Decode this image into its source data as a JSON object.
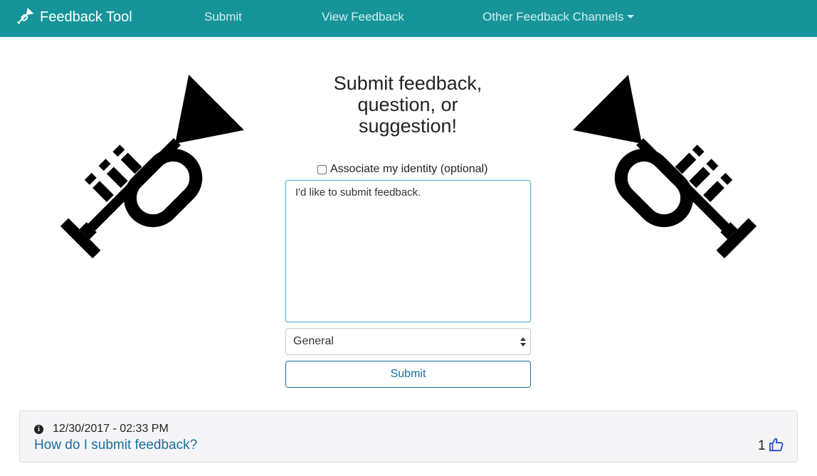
{
  "navbar": {
    "brand": "Feedback Tool",
    "links": {
      "submit": "Submit",
      "view": "View Feedback",
      "other": "Other Feedback Channels"
    },
    "background": "#17949a"
  },
  "form": {
    "title": "Submit feedback, question, or suggestion!",
    "identity_label": "Associate my identity (optional)",
    "identity_checked": false,
    "textarea_value": "I'd like to submit feedback.",
    "category_selected": "General",
    "submit_label": "Submit"
  },
  "feedback_items": [
    {
      "timestamp": "12/30/2017 - 02:33 PM",
      "title": "How do I submit feedback?",
      "likes": "1"
    }
  ],
  "icons": {
    "brand": "trumpet-icon",
    "decoration": "trumpet-icon",
    "info": "info-circle-icon",
    "like": "thumbs-up-icon"
  },
  "colors": {
    "accent": "#1a6ea0",
    "nav_bg": "#17949a"
  }
}
